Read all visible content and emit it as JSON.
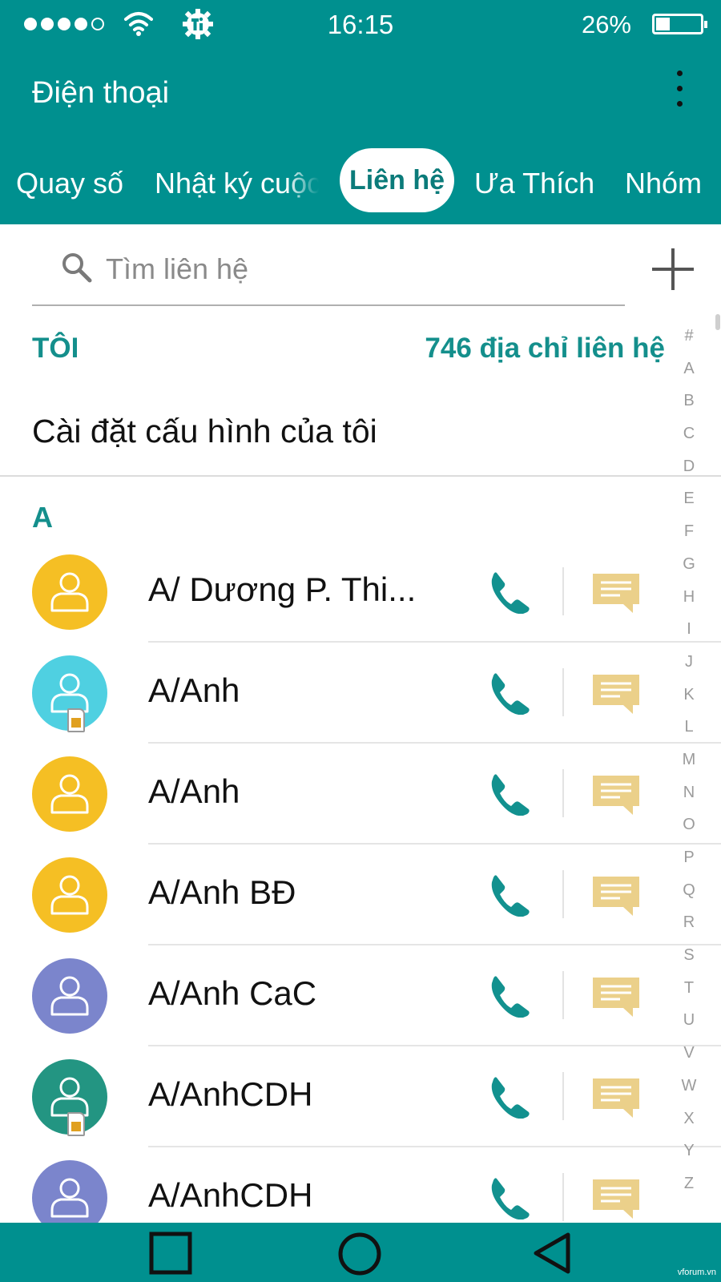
{
  "status_bar": {
    "time": "16:15",
    "battery": "26%"
  },
  "app": {
    "title": "Điện thoại"
  },
  "tabs": [
    {
      "label": "Quay số"
    },
    {
      "label": "Nhật ký cuộc gọi"
    },
    {
      "label": "Liên hệ",
      "active": true
    },
    {
      "label": "Ưa Thích"
    },
    {
      "label": "Nhóm"
    }
  ],
  "search": {
    "placeholder": "Tìm liên hệ"
  },
  "me": {
    "label": "TÔI",
    "count": "746 địa chỉ liên hệ",
    "profile": "Cài đặt cấu hình của tôi"
  },
  "section": {
    "letter": "A"
  },
  "contacts": [
    {
      "name": "A/ Dương P. Thi...",
      "avatar_color": "#f5bf24",
      "sim": false
    },
    {
      "name": "A/Anh",
      "avatar_color": "#4fd0e1",
      "sim": true
    },
    {
      "name": "A/Anh",
      "avatar_color": "#f5bf24",
      "sim": false
    },
    {
      "name": "A/Anh BĐ",
      "avatar_color": "#f5bf24",
      "sim": false
    },
    {
      "name": "A/Anh CaC",
      "avatar_color": "#7b85cc",
      "sim": false
    },
    {
      "name": "A/AnhCDH",
      "avatar_color": "#239582",
      "sim": true
    },
    {
      "name": "A/AnhCDH",
      "avatar_color": "#7b85cc",
      "sim": false
    }
  ],
  "index_letters": [
    "#",
    "A",
    "B",
    "C",
    "D",
    "E",
    "F",
    "G",
    "H",
    "I",
    "J",
    "K",
    "L",
    "M",
    "N",
    "O",
    "P",
    "Q",
    "R",
    "S",
    "T",
    "U",
    "V",
    "W",
    "X",
    "Y",
    "Z"
  ],
  "watermark": "vforum.vn",
  "colors": {
    "primary": "#00908f",
    "accent_text": "#148f8c",
    "message_icon": "#ebd08a"
  }
}
